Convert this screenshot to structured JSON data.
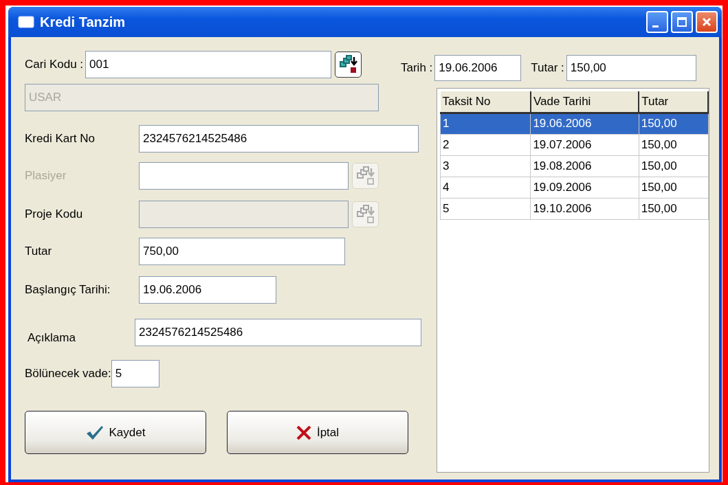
{
  "window": {
    "title": "Kredi Tanzim"
  },
  "cari": {
    "label": "Cari Kodu :",
    "value": "001",
    "button_disabled": false
  },
  "cari_name": {
    "value": "USAR",
    "disabled": true
  },
  "tarih": {
    "label": "Tarih :",
    "value": "19.06.2006"
  },
  "taksit_tutar": {
    "label": "Tutar :",
    "value": "150,00"
  },
  "fields": [
    {
      "label": "Kredi Kart No",
      "value": "2324576214525486",
      "kind": "text",
      "label_disabled": false,
      "disabled": false
    },
    {
      "label": "Plasiyer",
      "kind": "lookup",
      "label_disabled": true,
      "disabled": false,
      "button_disabled": true
    },
    {
      "label": "Proje Kodu",
      "kind": "lookup",
      "label_disabled": false,
      "disabled": true,
      "button_disabled": true
    },
    {
      "label": "Tutar",
      "value": "750,00",
      "kind": "text",
      "label_disabled": false,
      "disabled": false
    },
    {
      "label": "Başlangıç Tarihi:",
      "value": "19.06.2006",
      "kind": "text",
      "label_disabled": false,
      "disabled": false
    },
    {
      "label": "Açıklama",
      "value": "2324576214525486",
      "kind": "text",
      "label_disabled": false,
      "disabled": false
    },
    {
      "label": "Bölünecek vade:",
      "value": "5",
      "kind": "text",
      "label_disabled": false,
      "disabled": false
    }
  ],
  "table": {
    "columns": [
      "Taksit No",
      "Vade Tarihi",
      "Tutar"
    ],
    "rows": [
      {
        "cells": [
          "1",
          "19.06.2006",
          "150,00"
        ],
        "selected": true
      },
      {
        "cells": [
          "2",
          "19.07.2006",
          "150,00"
        ],
        "selected": false
      },
      {
        "cells": [
          "3",
          "19.08.2006",
          "150,00"
        ],
        "selected": false
      },
      {
        "cells": [
          "4",
          "19.09.2006",
          "150,00"
        ],
        "selected": false
      },
      {
        "cells": [
          "5",
          "19.10.2006",
          "150,00"
        ],
        "selected": false
      }
    ]
  },
  "buttons": [
    {
      "label": "Kaydet",
      "kind": "save"
    },
    {
      "label": "İptal",
      "kind": "cancel"
    }
  ]
}
